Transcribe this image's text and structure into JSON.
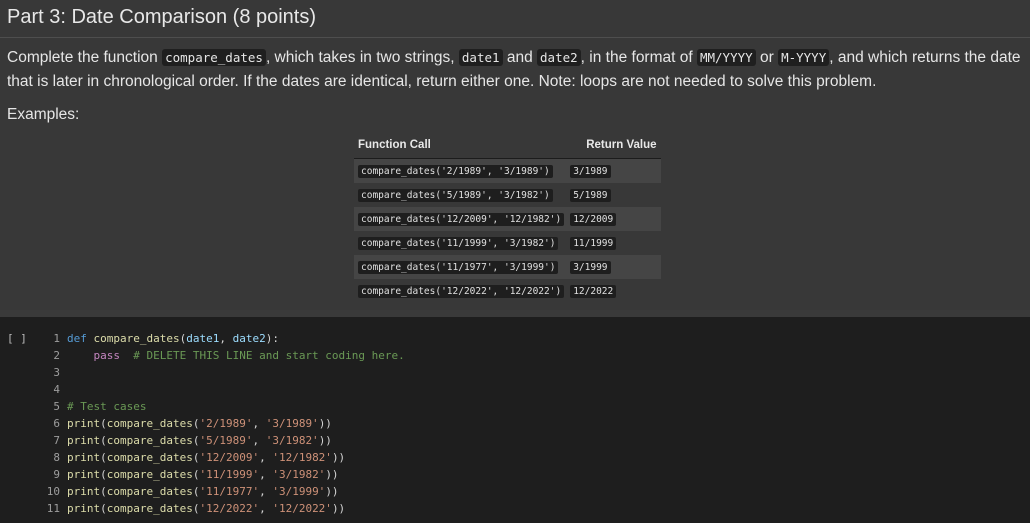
{
  "part_title": "Part 3: Date Comparison (8 points)",
  "description": {
    "t1": "Complete the function ",
    "c1": "compare_dates",
    "t2": ", which takes in two strings, ",
    "c2": "date1",
    "t3": " and ",
    "c3": "date2",
    "t4": ", in the format of ",
    "c4": "MM/YYYY",
    "t5": " or ",
    "c5": "M-YYYY",
    "t6": ", and which returns the date that is later in chronological order. If the dates are identical, return either one. Note: loops are not needed to solve this problem."
  },
  "examples_label": "Examples:",
  "table": {
    "headers": [
      "Function Call",
      "Return Value"
    ],
    "rows": [
      [
        "compare_dates('2/1989', '3/1989')",
        "3/1989"
      ],
      [
        "compare_dates('5/1989', '3/1982')",
        "5/1989"
      ],
      [
        "compare_dates('12/2009', '12/1982')",
        "12/2009"
      ],
      [
        "compare_dates('11/1999', '3/1982')",
        "11/1999"
      ],
      [
        "compare_dates('11/1977', '3/1999')",
        "3/1999"
      ],
      [
        "compare_dates('12/2022', '12/2022')",
        "12/2022"
      ]
    ]
  },
  "code_cell": {
    "run_indicator": "[ ]",
    "lines": [
      {
        "num": "1",
        "text": "def compare_dates(date1, date2):"
      },
      {
        "num": "2",
        "text": "    pass  # DELETE THIS LINE and start coding here."
      },
      {
        "num": "3",
        "text": ""
      },
      {
        "num": "4",
        "text": ""
      },
      {
        "num": "5",
        "text": "# Test cases"
      },
      {
        "num": "6",
        "text": "print(compare_dates('2/1989', '3/1989'))"
      },
      {
        "num": "7",
        "text": "print(compare_dates('5/1989', '3/1982'))"
      },
      {
        "num": "8",
        "text": "print(compare_dates('12/2009', '12/1982'))"
      },
      {
        "num": "9",
        "text": "print(compare_dates('11/1999', '3/1982'))"
      },
      {
        "num": "10",
        "text": "print(compare_dates('11/1977', '3/1999'))"
      },
      {
        "num": "11",
        "text": "print(compare_dates('12/2022', '12/2022'))"
      }
    ]
  }
}
